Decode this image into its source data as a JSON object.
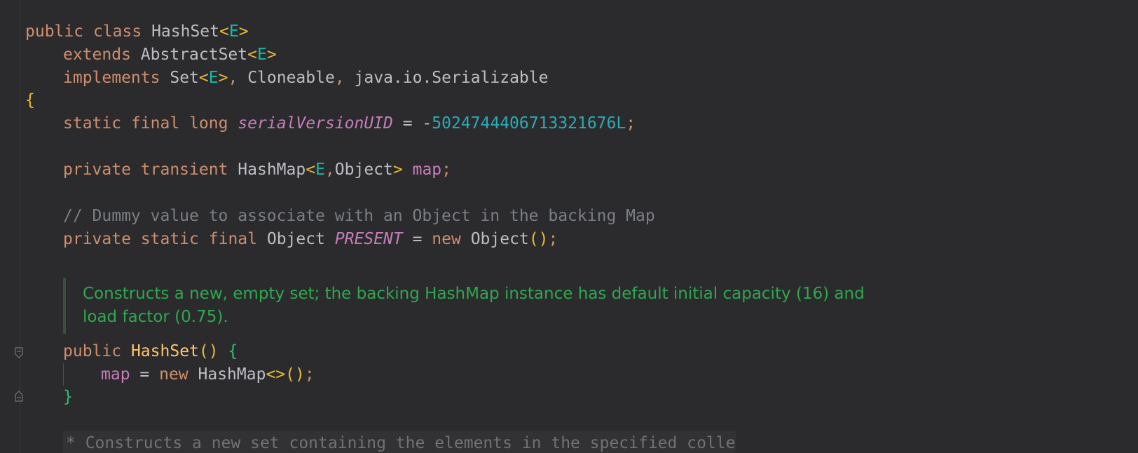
{
  "lines": {
    "l1": {
      "kw1": "public",
      "kw2": "class",
      "name": "HashSet",
      "lt": "<",
      "tp": "E",
      "gt": ">"
    },
    "l2": {
      "kw": "extends",
      "name": "AbstractSet",
      "lt": "<",
      "tp": "E",
      "gt": ">"
    },
    "l3": {
      "kw": "implements",
      "set": "Set",
      "lt": "<",
      "tp": "E",
      "gt": ">",
      "comma1": ",",
      "cloneable": "Cloneable",
      "comma2": ",",
      "serial": "java.io.Serializable"
    },
    "l4": {
      "brace": "{"
    },
    "l5": {
      "kw1": "static",
      "kw2": "final",
      "kw3": "long",
      "field": "serialVersionUID",
      "eq": " = -",
      "num": "5024744406713321676L",
      "semi": ";"
    },
    "l6": {
      "kw1": "private",
      "kw2": "transient",
      "type": "HashMap",
      "lt": "<",
      "tp": "E",
      "comma": ",",
      "obj": "Object",
      "gt": ">",
      "field": "map",
      "semi": ";"
    },
    "l7": {
      "comment": "// Dummy value to associate with an Object in the backing Map"
    },
    "l8": {
      "kw1": "private",
      "kw2": "static",
      "kw3": "final",
      "type": "Object",
      "field": "PRESENT",
      "eq": " = ",
      "kw4": "new",
      "obj": "Object",
      "paren": "()",
      "semi": ";"
    },
    "l9": {
      "kw": "public",
      "fn": "HashSet",
      "paren": "()",
      "brace": "{"
    },
    "l10": {
      "field": "map",
      "eq": " = ",
      "kw": "new",
      "type": "HashMap",
      "diamond": "<>",
      "paren": "()",
      "semi": ";"
    },
    "l11": {
      "brace": "}"
    }
  },
  "doc": {
    "line1": "Constructs a new, empty set; the backing HashMap instance has default initial capacity (16) and",
    "line2": "load factor (0.75)."
  },
  "bottom_strip": "* Constructs a new set containing the elements in the specified collection.",
  "icons": [
    "fold-start-icon",
    "fold-end-icon"
  ],
  "colors": {
    "background": "#2b2b2d",
    "keyword": "#cf8e6d",
    "type_param": "#16baac",
    "field": "#c77dbb",
    "number": "#2aacb8",
    "comment": "#7a7e85",
    "doc": "#2fa84f",
    "method": "#ffc66d"
  }
}
